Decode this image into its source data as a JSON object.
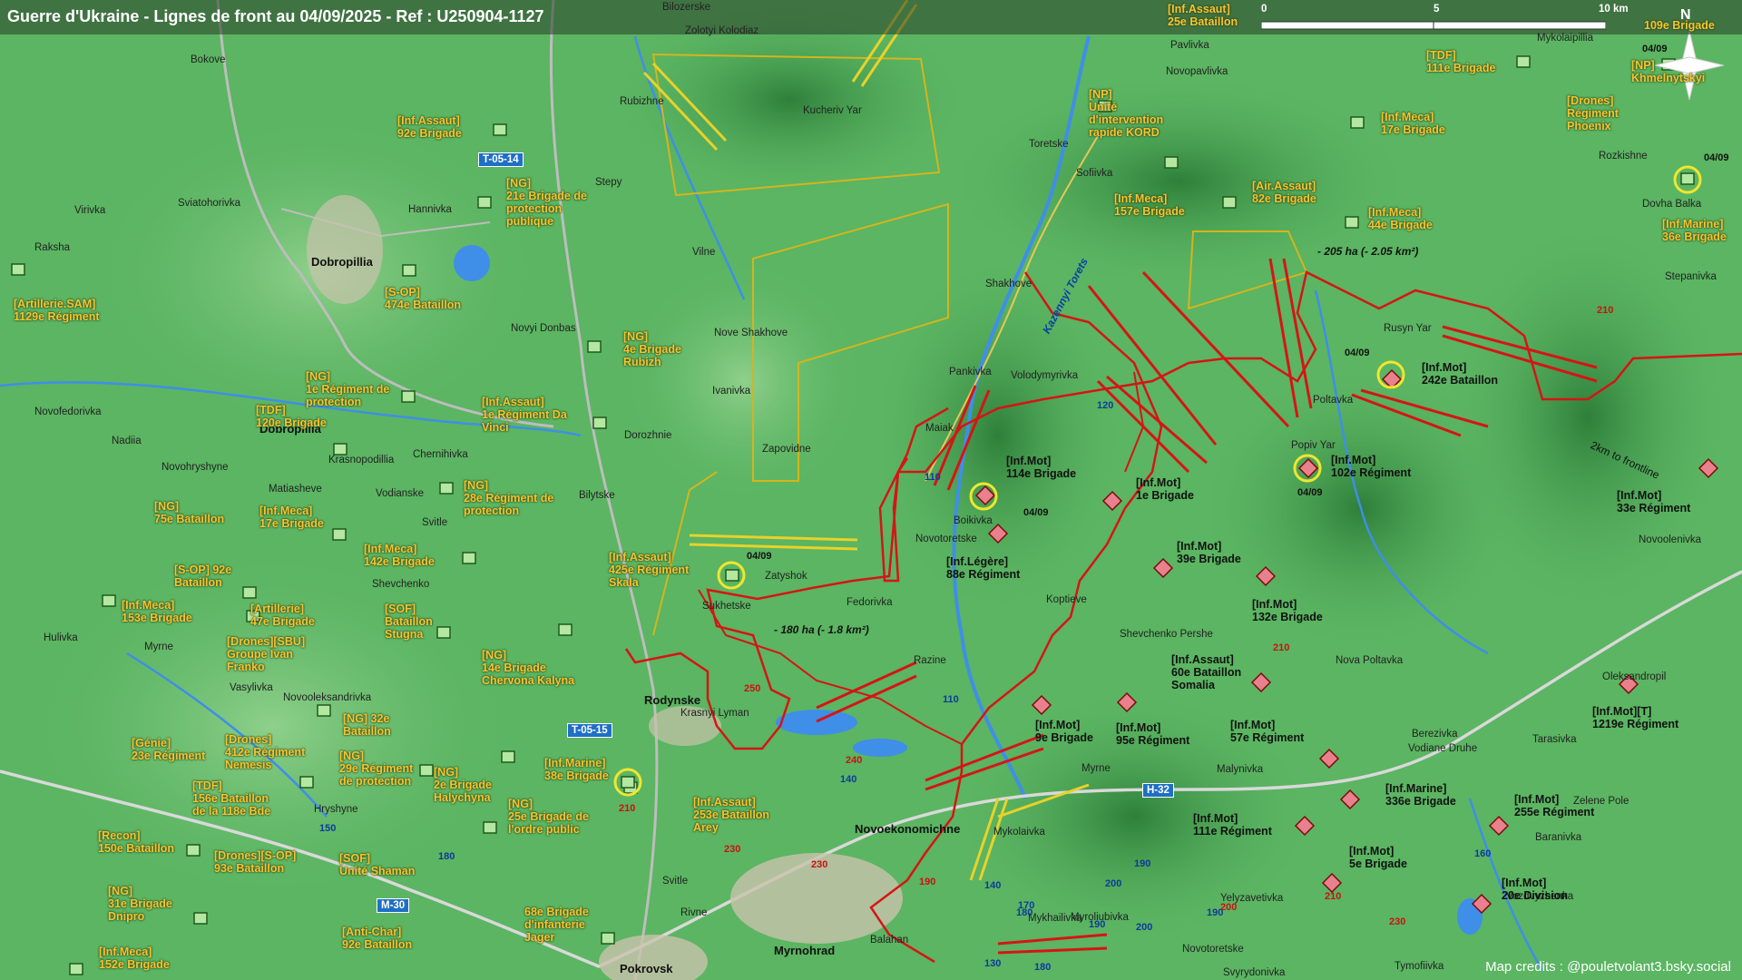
{
  "title": "Guerre d'Ukraine - Lignes de front au 04/09/2025 - Ref : U250904-1127",
  "credits": "Map credits : @pouletvolant3.bsky.social",
  "scale": {
    "t0": "0",
    "t5": "5",
    "t10": "10 km"
  },
  "compass": "N",
  "colors": {
    "front_line": "#d51515",
    "ua_units": "#f6c430",
    "roads": "#1f6fc6",
    "terrain": "#5bb562"
  },
  "places": [
    "Bilozerske",
    "Zolotyi Kolodiaz",
    "Bokove",
    "Rubizhne",
    "Kucheriv Yar",
    "Stepy",
    "Sviatohorivka",
    "Virivka",
    "Hannivka",
    "Raksha",
    "Dobropillia",
    "Vilne",
    "Nove Shakhove",
    "Novyi Donbas",
    "Ivanivka",
    "Novofedorivka",
    "Nadiia",
    "Dobropillia",
    "Dorozhnie",
    "Zapovidne",
    "Novohryshyne",
    "Krasnopodillia",
    "Chernihivka",
    "Matiasheve",
    "Vodianske",
    "Bilytske",
    "Svitle",
    "Shevchenko",
    "Zatyshok",
    "Sukhetske",
    "Fedorivka",
    "Hulivka",
    "Myrne",
    "Vasylivka",
    "Novooleksandrivka",
    "Rodynske",
    "Krasnyi Lyman",
    "Hryshyne",
    "Svitle",
    "Rivne",
    "Myrnohrad",
    "Balahan",
    "Pokrovsk",
    "Novoekonomichne",
    "Mykolaivka",
    "Mykhailivka",
    "Myroliubivka",
    "Novotoretske",
    "Svyrydonivka",
    "Pavlivka",
    "Novopavlivka",
    "Toretske",
    "Sofiivka",
    "Shakhove",
    "Pankivka",
    "Volodymyrivka",
    "Maiak",
    "Boikivka",
    "Novotoretske",
    "Koptieve",
    "Razine",
    "Shevchenko Pershe",
    "Malynivka",
    "Myrne",
    "Yelyzavetivka",
    "Rusyn Yar",
    "Poltavka",
    "Popiv Yar",
    "Novoolenivka",
    "Nova Poltavka",
    "Berezivka",
    "Vodiane Druhe",
    "Tarasivka",
    "Zelene Pole",
    "Oleksandropil",
    "Baranivka",
    "Vozdvyzhenka",
    "Tymofiivka",
    "Mykolaipillia",
    "Rozkishne",
    "Dovha Balka",
    "Stepanivka"
  ],
  "ua_units": [
    "[Inf.Assaut]\n92e Brigade",
    "[NG]\n21e Brigade de\nprotection\npublique",
    "[S-OP]\n474e Bataillon",
    "[Artillerie.SAM]\n1129e Régiment",
    "[NG]\n4e Brigade\nRubizh",
    "[NG]\n1e Régiment de\nprotection",
    "[Inf.Assaut]\n1e Régiment Da\nVinci",
    "[TDF]\n120e Brigade",
    "[NG]\n28e Régiment de\nprotection",
    "[NG]\n75e Bataillon",
    "[Inf.Meca]\n17e Brigade",
    "[Inf.Meca]\n142e Brigade",
    "[S-OP] 92e\nBataillon",
    "[Inf.Meca]\n153e Brigade",
    "[Artillerie]\n47e Brigade",
    "[SOF]\nBataillon\nStugna",
    "[Drones][SBU]\nGroupe Ivan\nFranko",
    "[NG]\n14e Brigade\nChervona Kalyna",
    "[Inf.Assaut]\n425e Régiment\nSkala",
    "[NG] 32e\nBataillon",
    "[Génie]\n23e Régiment",
    "[Drones]\n412e Régiment\nNemesis",
    "[NG]\n29e Régiment\nde protection",
    "[NG]\n2e Brigade\nHalychyna",
    "[TDF]\n156e Bataillon\nde la 118e Bde",
    "[NG]\n25e Brigade de\nl'ordre public",
    "[Inf.Marine]\n38e Brigade",
    "[Inf.Assaut]\n253e Bataillon\nArey",
    "[Recon]\n150e Bataillon",
    "[Drones][S-OP]\n93e Bataillon",
    "[SOF]\nUnité Shaman",
    "[NG]\n31e Brigade\nDnipro",
    "[Anti-Char]\n92e Bataillon",
    "68e Brigade\nd'infanterie\nJager",
    "[Inf.Meca]\n152e Brigade",
    "[Inf.Assaut]\n25e Bataillon",
    "[NP]\nUnité\nd'intervention\nrapide KORD",
    "[Inf.Meca]\n157e Brigade",
    "[Air.Assaut]\n82e Brigade",
    "[Inf.Meca]\n44e Brigade",
    "[Inf.Meca]\n17e Brigade",
    "[TDF]\n111e Brigade",
    "[Drones]\nRégiment\nPhoenix",
    "[NP]\nKhmelnytskyi",
    "109e Brigade",
    "[Inf.Marine]\n36e Brigade"
  ],
  "ru_units": [
    "[Inf.Mot]\n242e Bataillon",
    "[Inf.Mot]\n114e Brigade",
    "[Inf.Mot]\n1e Brigade",
    "[Inf.Mot]\n102e Régiment",
    "[Inf.Mot]\n33e Régiment",
    "[Inf.Légère]\n88e Régiment",
    "[Inf.Mot]\n39e Brigade",
    "[Inf.Mot]\n132e Brigade",
    "[Inf.Assaut]\n60e Bataillon\nSomalia",
    "[Inf.Mot]\n9e Brigade",
    "[Inf.Mot]\n95e Régiment",
    "[Inf.Mot]\n57e Régiment",
    "[Inf.Marine]\n336e Brigade",
    "[Inf.Mot]\n111e Régiment",
    "[Inf.Mot]\n5e Brigade",
    "[Inf.Mot]\n255e Régiment",
    "[Inf.Mot]\n20e Division",
    "[Inf.Mot][T]\n1219e Régiment"
  ],
  "road_signs": [
    "T-05-14",
    "T-05-15",
    "H-32",
    "M-30"
  ],
  "road_numbers": [
    "120",
    "110",
    "110",
    "140",
    "140",
    "150",
    "160",
    "130",
    "190",
    "180",
    "180",
    "170",
    "200",
    "190",
    "190",
    "180",
    "200"
  ],
  "road_numbers_red": [
    "210",
    "210",
    "250",
    "210",
    "240",
    "230",
    "230",
    "190",
    "200",
    "230",
    "210"
  ],
  "notes": [
    "- 205 ha (- 2.05 km²)",
    "- 180 ha (- 1.8 km²)",
    "Kazennyi Torets",
    "2km to frontline"
  ],
  "dates": [
    "04/09",
    "04/09",
    "04/09",
    "04/09",
    "04/09",
    "04/09"
  ]
}
